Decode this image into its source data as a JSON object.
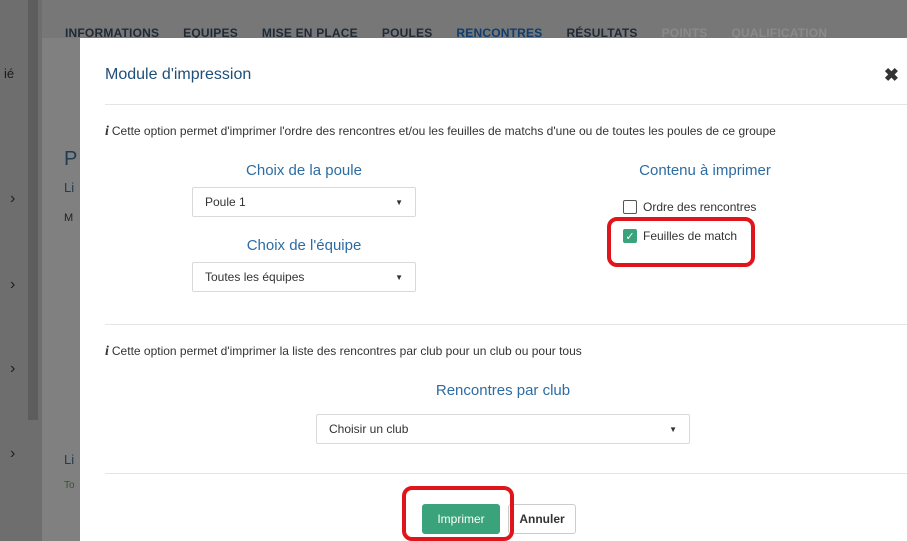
{
  "background": {
    "nav": [
      "INFORMATIONS",
      "EQUIPES",
      "MISE EN PLACE",
      "POULES",
      "RENCONTRES",
      "RÉSULTATS",
      "POINTS",
      "QUALIFICATION"
    ],
    "sidebar_partial_text": "ié",
    "letters": [
      "P",
      "Li",
      "M",
      "Li",
      "To"
    ]
  },
  "modal": {
    "title": "Module d'impression",
    "close_icon": "close-icon",
    "info1": "Cette option permet d'imprimer l'ordre des rencontres et/ou les feuilles de matchs d'une ou de toutes les poules de ce groupe",
    "poule_heading": "Choix de la poule",
    "poule_value": "Poule 1",
    "equipe_heading": "Choix de l'équipe",
    "equipe_value": "Toutes les équipes",
    "content_heading": "Contenu à imprimer",
    "opt_order": "Ordre des rencontres",
    "opt_order_checked": false,
    "opt_sheets": "Feuilles de match",
    "opt_sheets_checked": true,
    "info2": "Cette option permet d'imprimer la liste des rencontres par club pour un club ou pour tous",
    "club_heading": "Rencontres par club",
    "club_placeholder": "Choisir un club",
    "print_label": "Imprimer",
    "cancel_label": "Annuler"
  },
  "colors": {
    "accent": "#3aa37b",
    "heading": "#2d6ca2",
    "highlight": "#e0151b"
  }
}
